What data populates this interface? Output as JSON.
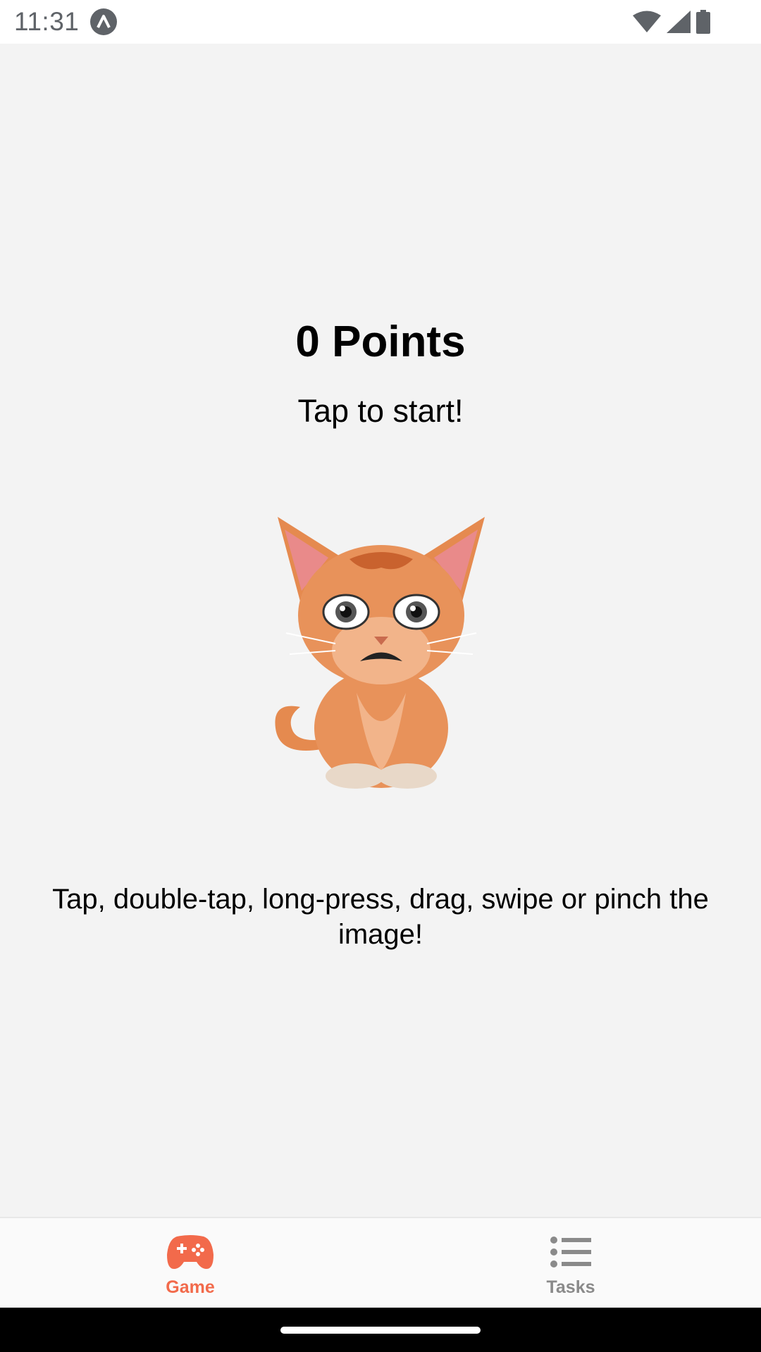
{
  "status_bar": {
    "time": "11:31",
    "app_icon": "expo-logo-icon",
    "icons": [
      "wifi-icon",
      "cellular-signal-icon",
      "battery-icon"
    ]
  },
  "game": {
    "points_title": "0 Points",
    "subtitle": "Tap to start!",
    "image": "cat-illustration",
    "instructions": "Tap, double-tap, long-press, drag, swipe or pinch the image!"
  },
  "tabs": [
    {
      "label": "Game",
      "icon": "gamepad-icon",
      "active": true
    },
    {
      "label": "Tasks",
      "icon": "list-icon",
      "active": false
    }
  ],
  "colors": {
    "accent": "#f26a4b",
    "inactive": "#8a8a8a",
    "background": "#f3f3f3"
  }
}
